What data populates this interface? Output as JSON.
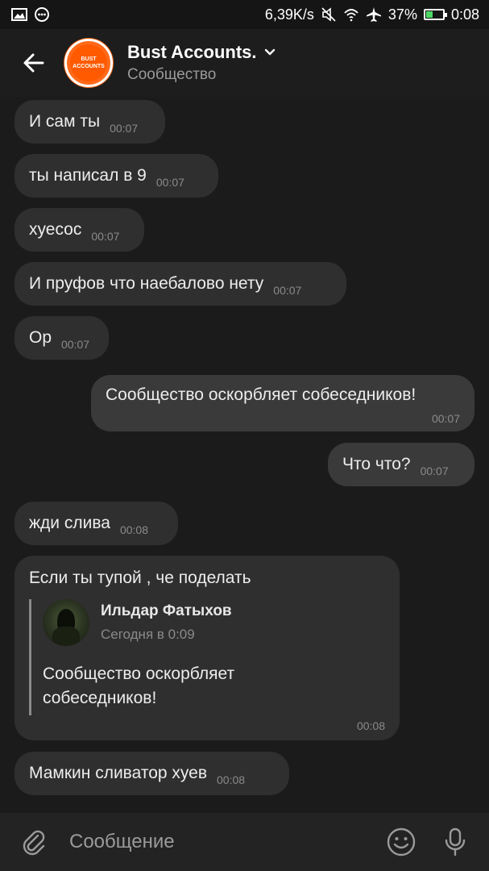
{
  "status_bar": {
    "speed": "6,39K/s",
    "battery": "37%",
    "battery_level": 0.37,
    "time": "0:08",
    "icons": [
      "gallery-icon",
      "messenger-icon",
      "mute-icon",
      "wifi-icon",
      "airplane-icon"
    ]
  },
  "header": {
    "title": "Bust Accounts.",
    "subtitle": "Сообщество",
    "avatar_text_line1": "BUST",
    "avatar_text_line2": "ACCOUNTS",
    "accent_color": "#ff6a1a"
  },
  "messages": [
    {
      "text": "И сам ты",
      "time": "00:07",
      "direction": "in"
    },
    {
      "text": "ты написал в 9",
      "time": "00:07",
      "direction": "in"
    },
    {
      "text": "хуесос",
      "time": "00:07",
      "direction": "in"
    },
    {
      "text": "И пруфов что наебалово нету",
      "time": "00:07",
      "direction": "in"
    },
    {
      "text": "Ор",
      "time": "00:07",
      "direction": "in"
    },
    {
      "text": "Сообщество оскорбляет собеседников!",
      "time": "00:07",
      "direction": "out"
    },
    {
      "text": "Что что?",
      "time": "00:07",
      "direction": "out"
    },
    {
      "text": "жди слива",
      "time": "00:08",
      "direction": "in"
    },
    {
      "text": "Если ты тупой , че поделать",
      "time": "00:08",
      "direction": "in",
      "quote": {
        "author": "Ильдар Фатыхов",
        "date": "Сегодня в 0:09",
        "text": "Сообщество оскорбляет собеседников!"
      }
    },
    {
      "text": "Мамкин сливатор хуев",
      "time": "00:08",
      "direction": "in"
    }
  ],
  "input": {
    "placeholder": "Сообщение"
  }
}
